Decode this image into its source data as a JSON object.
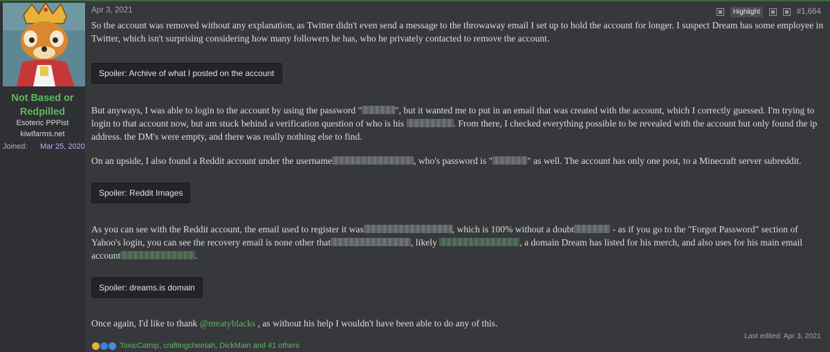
{
  "user": {
    "name_line1": "Not Based or",
    "name_line2": "Redpilled",
    "title": "Esoteric PPPist",
    "host": "kiwifarms.net",
    "joined_label": "Joined:",
    "joined_date": "Mar 25, 2020"
  },
  "post": {
    "date": "Apr 3, 2021",
    "highlight_label": "Highlight",
    "number": "#1,664",
    "p1": "So the account was removed without any explanation, as Twitter didn't even send a message to the throwaway email I set up to hold the account for longer. I suspect Dream has some employee in Twitter, which isn't surprising considering how many followers he has, who he privately contacted to remove the account.",
    "spoiler1": "Spoiler: Archive of what I posted on the account",
    "p2a": "But anyways, I was able to login to the account by using the password \"",
    "p2b": "\", but it wanted me to put in an email that was created with the account, which I correctly guessed. I'm trying to login to that account now, but am stuck behind a verification question of who is his",
    "p2c": ". From there, I checked everything possible to be revealed with the account but only found the ip address. the DM's were empty, and there was really nothing else to find.",
    "p3a": "On an upside, I also found a Reddit account under the username",
    "p3b": ", who's password is \"",
    "p3c": "\" as well. The account has only one post, to a Minecraft server subreddit.",
    "spoiler2": "Spoiler: Reddit Images",
    "p4a": "As you can see with the Reddit account, the email used to register it was",
    "p4b": ", which is 100% without a doubt",
    "p4c": " - as if you go to the \"Forgot Password\" section of Yahoo's login, you can see the recovery email is none other that",
    "p4d": ", likely",
    "p4e": ", a domain Dream has listed for his merch, and also uses for his main email account",
    "p4f": ".",
    "spoiler3": "Spoiler: dreams.is domain",
    "p5a": "Once again, I'd like to thank ",
    "p5_mention": "@meatyblacks",
    "p5b": " , as without his help I wouldn't have been able to do any of this.",
    "last_edited": "Last edited: Apr 3, 2021",
    "reactions_text": "ToxicCatnip, craftingcheetah, DickMain and 41 others"
  },
  "colors": {
    "username": "#5fb85f",
    "joined_date": "#c5a7ff",
    "background": "#36383c",
    "sidebar": "#2e3033"
  }
}
